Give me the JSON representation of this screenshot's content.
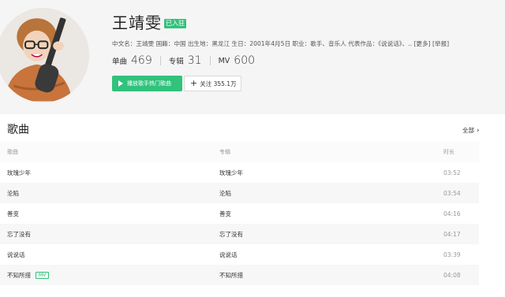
{
  "artist": {
    "name": "王靖雯",
    "badge": "已入驻",
    "info": "中文名：王靖雯  国籍：中国  出生地：黑龙江  生日：2001年4月5日  职业：歌手、音乐人  代表作品：《说说话》、..  [更多]  [举报]"
  },
  "stats": {
    "songs_label": "单曲",
    "songs_value": "469",
    "albums_label": "专辑",
    "albums_value": "31",
    "mv_label": "MV",
    "mv_value": "600"
  },
  "buttons": {
    "play_label": "播放歌手热门歌曲",
    "follow_label": "关注 355.1万"
  },
  "songs_section": {
    "title": "歌曲",
    "all_label": "全部"
  },
  "table": {
    "headers": {
      "song": "歌曲",
      "album": "专辑",
      "duration": "时长"
    },
    "rows": [
      {
        "title": "玫瑰少年",
        "album": "玫瑰少年",
        "duration": "03:52",
        "mv": ""
      },
      {
        "title": "沦陷",
        "album": "沦陷",
        "duration": "03:54",
        "mv": ""
      },
      {
        "title": "善变",
        "album": "善变",
        "duration": "04:16",
        "mv": ""
      },
      {
        "title": "忘了没有",
        "album": "忘了没有",
        "duration": "04:17",
        "mv": ""
      },
      {
        "title": "说说话",
        "album": "说说话",
        "duration": "03:39",
        "mv": ""
      },
      {
        "title": "不知所措",
        "album": "不知所措",
        "duration": "04:08",
        "mv": "MV"
      }
    ]
  },
  "colors": {
    "accent": "#31c27c",
    "header_bg": "#f5f5f5"
  }
}
